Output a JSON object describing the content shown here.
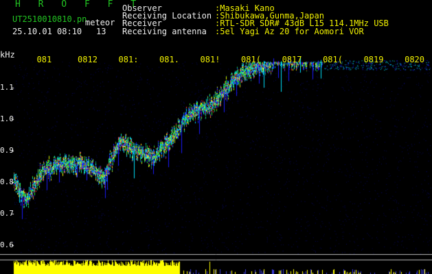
{
  "header": {
    "brand": "H R O F F T",
    "filename": "UT2510010810.pn",
    "mode": "meteor",
    "datetime": "25.10.01 08:10",
    "count": "13",
    "labels": [
      "Observer",
      "Receiving Location",
      "Receiver",
      "Receiving antenna"
    ],
    "values": [
      ":Masaki Kano",
      ":Shibukawa,Gunma,Japan",
      ":RTL-SDR SDR# 43dB L15 114.1MHz USB",
      ":5el Yagi Az 20 for Aomori VOR"
    ]
  },
  "chart_data": {
    "type": "heatmap",
    "ylabel": "kHz",
    "y_ticks": [
      "1.1",
      "1.0",
      "0.9",
      "0.8",
      "0.7",
      "0.6"
    ],
    "y_tick_values": [
      1.1,
      1.0,
      0.9,
      0.8,
      0.7,
      0.6
    ],
    "x_ticks": [
      "081",
      "0812",
      "081:",
      "081.",
      "081!",
      "081(",
      "0817",
      "081(",
      "0819",
      "0820"
    ],
    "x_tick_minutes": [
      10.0,
      11.0,
      12.0,
      13.0,
      14.0,
      15.0,
      16.0,
      17.0,
      18.0,
      19.0,
      20.0
    ],
    "ylim": [
      0.57,
      1.2
    ],
    "trace": {
      "x_minutes": [
        10.0,
        10.3,
        10.7,
        11.2,
        11.7,
        12.2,
        12.6,
        13.0,
        13.4,
        13.8,
        14.3,
        14.8,
        15.2,
        15.6,
        16.0,
        16.5,
        17.0,
        17.5
      ],
      "y_khz": [
        0.8,
        0.74,
        0.84,
        0.86,
        0.86,
        0.82,
        0.93,
        0.9,
        0.88,
        0.93,
        1.02,
        1.04,
        1.1,
        1.15,
        1.17,
        1.19,
        1.19,
        1.19
      ]
    },
    "colors": {
      "background": "#000000",
      "low": "#1a1aff",
      "mid": "#00e5ff",
      "high": "#28e028",
      "peak": "#ffff00",
      "hot": "#ff3030",
      "tick_text": "#ffff00",
      "axis_text": "#ffffff",
      "power_bar": "#ffff00"
    }
  }
}
